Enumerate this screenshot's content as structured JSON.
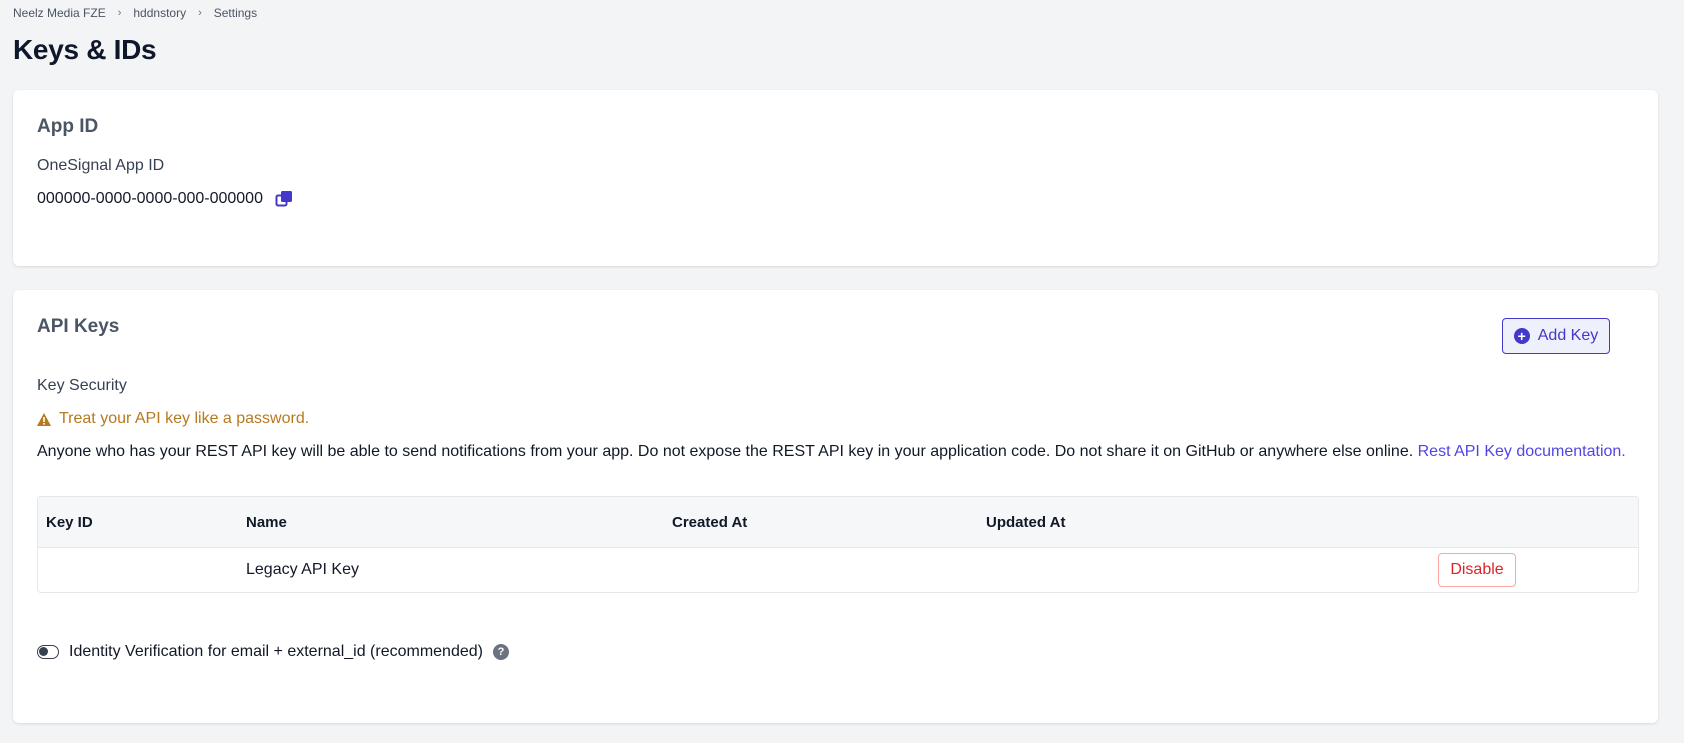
{
  "breadcrumb": {
    "items": [
      "Neelz Media FZE",
      "hddnstory",
      "Settings"
    ],
    "separator": "›"
  },
  "page": {
    "title": "Keys & IDs"
  },
  "app_id_card": {
    "title": "App ID",
    "label": "OneSignal App ID",
    "value": "000000-0000-0000-000-000000",
    "copy_icon": "copy-icon"
  },
  "api_keys_card": {
    "title": "API Keys",
    "add_key_label": "Add Key",
    "key_security_label": "Key Security",
    "warning_text": "Treat your API key like a password.",
    "description": "Anyone who has your REST API key will be able to send notifications from your app. Do not expose the REST API key in your application code. Do not share it on GitHub or anywhere else online.",
    "doc_link": "Rest API Key documentation.",
    "table": {
      "headers": [
        "Key ID",
        "Name",
        "Created At",
        "Updated At"
      ],
      "rows": [
        {
          "key_id": "",
          "name": "Legacy API Key",
          "created_at": "",
          "updated_at": "",
          "action": "Disable"
        }
      ]
    },
    "identity_verification_label": "Identity Verification for email + external_id (recommended)",
    "identity_verification_enabled": false,
    "help_icon": "?"
  },
  "colors": {
    "accent": "#4338ca",
    "warning": "#b7791f",
    "danger": "#dc2626",
    "background": "#f3f4f6"
  }
}
